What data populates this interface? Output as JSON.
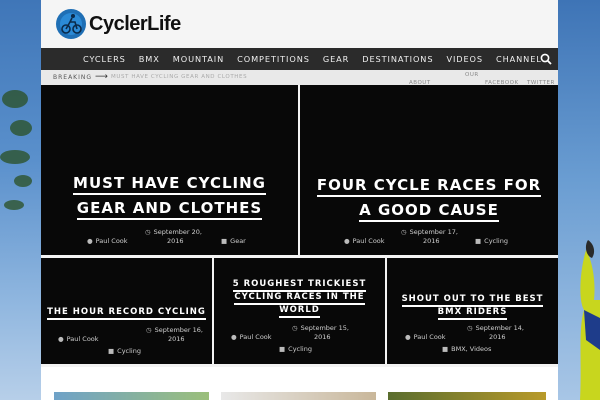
{
  "brand": {
    "name": "CyclerLife"
  },
  "nav": {
    "items": [
      "CYCLERS",
      "BMX",
      "MOUNTAIN",
      "COMPETITIONS",
      "GEAR",
      "DESTINATIONS",
      "VIDEOS",
      "CHANNEL"
    ],
    "search_icon": "search-icon"
  },
  "breaking": {
    "label": "BREAKING",
    "text": "MUST HAVE CYCLING GEAR AND CLOTHES",
    "links": {
      "about": "ABOUT",
      "our": "OUR",
      "facebook": "FACEBOOK",
      "twitter": "TWITTER"
    }
  },
  "featured": [
    {
      "title_lines": [
        "MUST HAVE CYCLING",
        "GEAR AND CLOTHES"
      ],
      "date_line1": "September 20,",
      "date_line2": "2016",
      "author": "Paul Cook",
      "category": "Gear"
    },
    {
      "title_lines": [
        "FOUR CYCLE RACES FOR",
        "A GOOD CAUSE"
      ],
      "date_line1": "September 17,",
      "date_line2": "2016",
      "author": "Paul Cook",
      "category": "Cycling"
    }
  ],
  "posts": [
    {
      "title_lines": [
        "THE HOUR RECORD CYCLING"
      ],
      "date_line1": "September 16,",
      "date_line2": "2016",
      "author": "Paul Cook",
      "category": "Cycling"
    },
    {
      "title_lines": [
        "5 ROUGHEST TRICKIEST",
        "CYCLING RACES IN THE",
        "WORLD"
      ],
      "date_line1": "September 15,",
      "date_line2": "2016",
      "author": "Paul Cook",
      "category": "Cycling"
    },
    {
      "title_lines": [
        "SHOUT OUT TO THE BEST",
        "BMX RIDERS"
      ],
      "date_line1": "September 14,",
      "date_line2": "2016",
      "author": "Paul Cook",
      "category": "BMX, Videos"
    }
  ],
  "colors": {
    "nav_bg": "#2b2b2b",
    "card_bg": "#080808",
    "header_bg": "#f5f5f5",
    "logo_blue": "#1f6fb5"
  }
}
